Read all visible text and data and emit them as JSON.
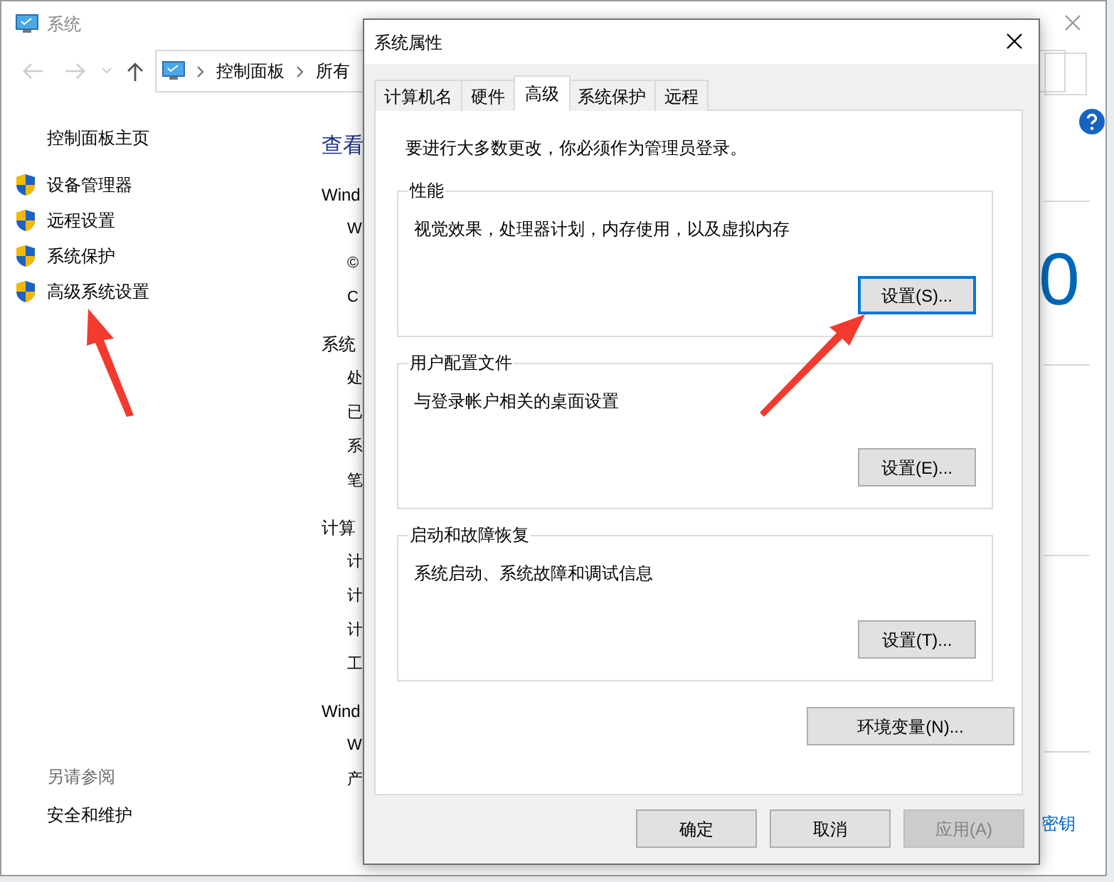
{
  "window": {
    "title": "系统"
  },
  "address": {
    "crumbs": [
      "控制面板",
      "所有"
    ]
  },
  "sidebar": {
    "home": "控制面板主页",
    "items": [
      {
        "label": "设备管理器"
      },
      {
        "label": "远程设置"
      },
      {
        "label": "系统保护"
      },
      {
        "label": "高级系统设置"
      }
    ],
    "see_also_title": "另请参阅",
    "see_also": [
      "安全和维护"
    ]
  },
  "main": {
    "heading": "查看",
    "lines": [
      {
        "kind": "section",
        "text": "Wind"
      },
      {
        "kind": "item",
        "text": "W"
      },
      {
        "kind": "item",
        "text": "©"
      },
      {
        "kind": "item",
        "text": "C"
      },
      {
        "kind": "section",
        "text": "系统"
      },
      {
        "kind": "item",
        "text": "处"
      },
      {
        "kind": "item",
        "text": "已"
      },
      {
        "kind": "item",
        "text": "系"
      },
      {
        "kind": "item",
        "text": "笔"
      },
      {
        "kind": "section",
        "text": "计算"
      },
      {
        "kind": "item",
        "text": "计"
      },
      {
        "kind": "item",
        "text": "计"
      },
      {
        "kind": "item",
        "text": "计"
      },
      {
        "kind": "item",
        "text": "工"
      },
      {
        "kind": "section",
        "text": "Wind"
      },
      {
        "kind": "item",
        "text": "W"
      },
      {
        "kind": "item",
        "text": "产"
      }
    ],
    "big_digit": "0",
    "link": "密钥"
  },
  "dialog": {
    "title": "系统属性",
    "tabs": [
      {
        "label": "计算机名",
        "selected": false
      },
      {
        "label": "硬件",
        "selected": false
      },
      {
        "label": "高级",
        "selected": true
      },
      {
        "label": "系统保护",
        "selected": false
      },
      {
        "label": "远程",
        "selected": false
      }
    ],
    "note": "要进行大多数更改，你必须作为管理员登录。",
    "groups": [
      {
        "title": "性能",
        "description": "视觉效果，处理器计划，内存使用，以及虚拟内存",
        "button": "设置(S)...",
        "focused": true
      },
      {
        "title": "用户配置文件",
        "description": "与登录帐户相关的桌面设置",
        "button": "设置(E)...",
        "focused": false
      },
      {
        "title": "启动和故障恢复",
        "description": "系统启动、系统故障和调试信息",
        "button": "设置(T)...",
        "focused": false
      }
    ],
    "env_button": "环境变量(N)...",
    "footer_buttons": [
      {
        "label": "确定",
        "disabled": false
      },
      {
        "label": "取消",
        "disabled": false
      },
      {
        "label": "应用(A)",
        "disabled": true
      }
    ]
  }
}
